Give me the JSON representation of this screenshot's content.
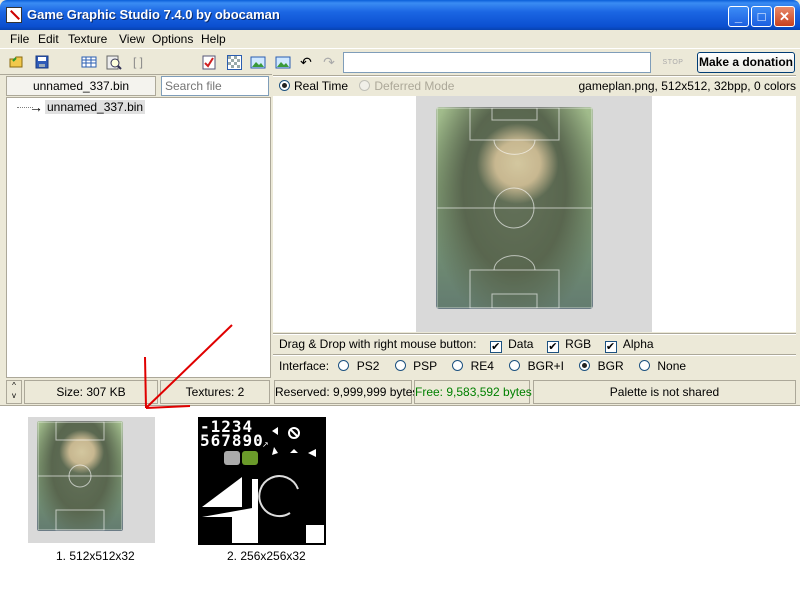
{
  "window": {
    "title": "Game Graphic Studio 7.4.0 by obocaman"
  },
  "menu": [
    "File",
    "Edit",
    "Texture",
    "View",
    "Options",
    "Help"
  ],
  "left_panel": {
    "file_button": "unnamed_337.bin",
    "search_placeholder": "Search file",
    "tree_item": "unnamed_337.bin"
  },
  "toolbar": {
    "stop_label": "STOP",
    "donate_label": "Make a donation"
  },
  "preview": {
    "mode_realtime": "Real Time",
    "mode_deferred": "Deferred Mode",
    "file_info": "gameplan.png, 512x512, 32bpp, 0 colors"
  },
  "dragdrop": {
    "label": "Drag & Drop with right mouse button:",
    "data": "Data",
    "rgb": "RGB",
    "alpha": "Alpha"
  },
  "interface": {
    "label": "Interface:",
    "options": [
      "PS2",
      "PSP",
      "RE4",
      "BGR+I",
      "BGR",
      "None"
    ],
    "selected": "BGR"
  },
  "status": {
    "size": "Size: 307 KB",
    "textures": "Textures: 2",
    "reserved": "Reserved: 9,999,999 bytes",
    "free": "Free: 9,583,592 bytes",
    "palette": "Palette is not shared"
  },
  "thumbnails": [
    {
      "caption": "1. 512x512x32"
    },
    {
      "caption": "2. 256x256x32"
    }
  ],
  "texture2_text": {
    "row1": "-1234",
    "row2": "567890"
  },
  "colors": {
    "title_blue": "#0b4fd0",
    "free_green": "#008000",
    "arrow_red": "#e00000"
  }
}
